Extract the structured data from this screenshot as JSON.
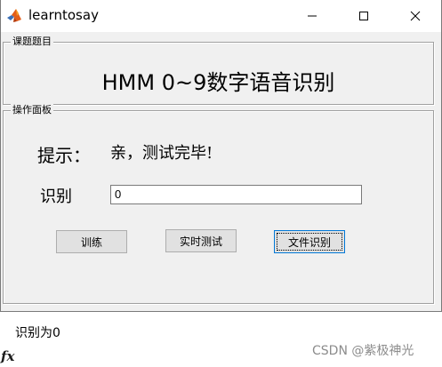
{
  "window": {
    "title": "learntosay",
    "icon": "matlab-icon"
  },
  "caption_buttons": [
    "minimize-icon",
    "maximize-icon",
    "close-icon"
  ],
  "group_title": {
    "legend": "课题题目",
    "heading": "HMM 0~9数字语音识别"
  },
  "group_ops": {
    "legend": "操作面板",
    "hint_label": "提示：",
    "hint_text": "亲，测试完毕!",
    "result_label": "识别",
    "result_value": "0",
    "buttons": {
      "train": "训练",
      "realtime": "实时测试",
      "file": "文件识别"
    }
  },
  "console": {
    "prompt_symbol": "fx",
    "output": "识别为0"
  },
  "watermark": "CSDN @紫极神光"
}
